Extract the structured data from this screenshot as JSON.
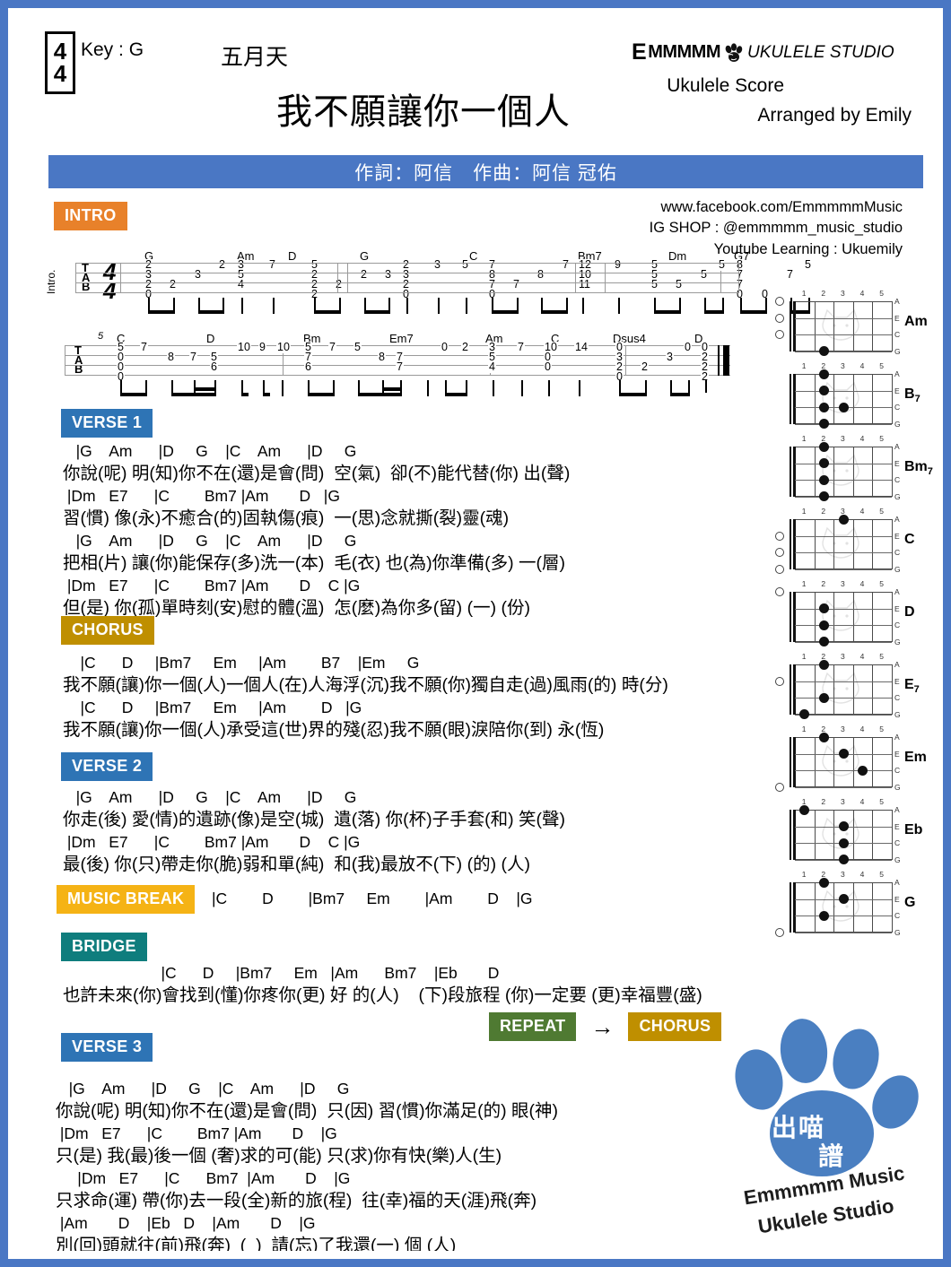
{
  "header": {
    "time_signature_top": "4",
    "time_signature_bottom": "4",
    "key": "Key : G",
    "artist": "五月天",
    "title": "我不願讓你一個人",
    "brand_e": "E",
    "brand_m": "MMMMM",
    "brand_tail": "UKULELE STUDIO",
    "score_label": "Ukulele Score",
    "arranged_by": "Arranged by Emily",
    "credits": "作詞：阿信　作曲：阿信 冠佑"
  },
  "social": {
    "facebook": "www.facebook.com/EmmmmmMusic",
    "ig": "IG SHOP : @emmmmm_music_studio",
    "youtube": "Youtube Learning : Ukuemily"
  },
  "tags": {
    "intro": "INTRO",
    "verse1": "VERSE 1",
    "chorus": "CHORUS",
    "verse2": "VERSE 2",
    "music_break": "MUSIC BREAK",
    "bridge": "BRIDGE",
    "repeat": "REPEAT",
    "repeat_target": "CHORUS",
    "arrow": "→",
    "verse3": "VERSE 3"
  },
  "tab": {
    "intro_label": "Intro.",
    "clef": [
      "T",
      "A",
      "B"
    ],
    "time_top": "4",
    "time_bottom": "4",
    "row1_chords": [
      "G",
      "Am",
      "D",
      "G",
      "C",
      "Bm7",
      "Dm",
      "G7"
    ],
    "row2_chords": [
      "C",
      "D",
      "Bm",
      "Em7",
      "Am",
      "C",
      "Dsus4",
      "D"
    ],
    "row2_pos_marker": "5"
  },
  "music_break_chords": "|C        D        |Bm7     Em        |Am        D    |G",
  "sections": {
    "verse1": [
      {
        "chords": "   |G    Am      |D     G    |C    Am      |D     G",
        "lyrics": "你說(呢) 明(知)你不在(還)是會(問)  空(氣)  卻(不)能代替(你) 出(聲)"
      },
      {
        "chords": " |Dm   E7      |C        Bm7 |Am       D   |G",
        "lyrics": "習(慣) 像(永)不癒合(的)固執傷(痕)  一(思)念就撕(裂)靈(魂)"
      },
      {
        "chords": "   |G    Am      |D     G    |C    Am      |D     G",
        "lyrics": "把相(片) 讓(你)能保存(多)洗一(本)  毛(衣) 也(為)你準備(多) 一(層)"
      },
      {
        "chords": " |Dm   E7      |C        Bm7 |Am       D    C |G",
        "lyrics": "但(是) 你(孤)單時刻(安)慰的體(溫)  怎(麼)為你多(留) (一) (份)"
      }
    ],
    "chorus": [
      {
        "chords": "    |C      D     |Bm7     Em     |Am        B7    |Em     G",
        "lyrics": "我不願(讓)你一個(人)一個人(在)人海浮(沉)我不願(你)獨自走(過)風雨(的) 時(分)"
      },
      {
        "chords": "    |C      D     |Bm7     Em     |Am        D   |G",
        "lyrics": "我不願(讓)你一個(人)承受這(世)界的殘(忍)我不願(眼)淚陪你(到) 永(恆)"
      }
    ],
    "verse2": [
      {
        "chords": "   |G    Am      |D     G    |C    Am      |D     G",
        "lyrics": "你走(後) 愛(情)的遺跡(像)是空(城)  遺(落) 你(杯)子手套(和) 笑(聲)"
      },
      {
        "chords": " |Dm   E7      |C        Bm7 |Am       D    C |G",
        "lyrics": "最(後) 你(只)帶走你(脆)弱和單(純)  和(我)最放不(下) (的) (人)"
      }
    ],
    "bridge": [
      {
        "chords": "    |C      D     |Bm7     Em   |Am      Bm7    |Eb       D",
        "lyrics": "也許未來(你)會找到(懂)你疼你(更) 好 的(人)    (下)段旅程 (你)一定要 (更)幸福豐(盛)"
      }
    ],
    "verse3": [
      {
        "chords": "   |G    Am      |D     G    |C    Am      |D     G",
        "lyrics": "你說(呢) 明(知)你不在(還)是會(問)  只(因) 習(慣)你滿足(的) 眼(神)"
      },
      {
        "chords": " |Dm   E7      |C        Bm7 |Am       D    |G",
        "lyrics": "只(是) 我(最)後一個 (奢)求的可(能) 只(求)你有快(樂)人(生)"
      },
      {
        "chords": "     |Dm   E7      |C      Bm7  |Am       D    |G",
        "lyrics": "只求命(運) 帶(你)去一段(全)新的旅(程)  往(幸)福的天(涯)飛(奔)"
      },
      {
        "chords": " |Am       D    |Eb   D    |Am       D    |G",
        "lyrics": "別(回)頭就往(前)飛(奔)  (  )  請(忘)了我還(一) 個 (人)"
      }
    ]
  },
  "chord_diagrams": [
    {
      "name": "Am",
      "sub": "",
      "fret_numbers": [
        "1",
        "2",
        "3",
        "4",
        "5"
      ],
      "string_names": [
        "A",
        "E",
        "C",
        "G"
      ],
      "open_strings": [
        0,
        1,
        2
      ],
      "dots": [
        {
          "string": 3,
          "fret": 2
        }
      ]
    },
    {
      "name": "B",
      "sub": "7",
      "fret_numbers": [
        "1",
        "2",
        "3",
        "4",
        "5"
      ],
      "string_names": [
        "A",
        "E",
        "C",
        "G"
      ],
      "open_strings": [],
      "dots": [
        {
          "string": 0,
          "fret": 2
        },
        {
          "string": 1,
          "fret": 2
        },
        {
          "string": 2,
          "fret": 2
        },
        {
          "string": 3,
          "fret": 2
        },
        {
          "string": 2,
          "fret": 3
        }
      ]
    },
    {
      "name": "Bm",
      "sub": "7",
      "fret_numbers": [
        "1",
        "2",
        "3",
        "4",
        "5"
      ],
      "string_names": [
        "A",
        "E",
        "C",
        "G"
      ],
      "open_strings": [],
      "dots": [
        {
          "string": 0,
          "fret": 2
        },
        {
          "string": 1,
          "fret": 2
        },
        {
          "string": 2,
          "fret": 2
        },
        {
          "string": 3,
          "fret": 2
        }
      ]
    },
    {
      "name": "C",
      "sub": "",
      "fret_numbers": [
        "1",
        "2",
        "3",
        "4",
        "5"
      ],
      "string_names": [
        "A",
        "E",
        "C",
        "G"
      ],
      "open_strings": [
        1,
        2,
        3
      ],
      "dots": [
        {
          "string": 0,
          "fret": 3
        }
      ]
    },
    {
      "name": "D",
      "sub": "",
      "fret_numbers": [
        "1",
        "2",
        "3",
        "4",
        "5"
      ],
      "string_names": [
        "A",
        "E",
        "C",
        "G"
      ],
      "open_strings": [
        0
      ],
      "dots": [
        {
          "string": 1,
          "fret": 2
        },
        {
          "string": 2,
          "fret": 2
        },
        {
          "string": 3,
          "fret": 2
        }
      ]
    },
    {
      "name": "E",
      "sub": "7",
      "fret_numbers": [
        "1",
        "2",
        "3",
        "4",
        "5"
      ],
      "string_names": [
        "A",
        "E",
        "C",
        "G"
      ],
      "open_strings": [
        1
      ],
      "dots": [
        {
          "string": 0,
          "fret": 2
        },
        {
          "string": 2,
          "fret": 2
        },
        {
          "string": 3,
          "fret": 1
        }
      ]
    },
    {
      "name": "Em",
      "sub": "",
      "fret_numbers": [
        "1",
        "2",
        "3",
        "4",
        "5"
      ],
      "string_names": [
        "A",
        "E",
        "C",
        "G"
      ],
      "open_strings": [
        3
      ],
      "dots": [
        {
          "string": 0,
          "fret": 2
        },
        {
          "string": 1,
          "fret": 3
        },
        {
          "string": 2,
          "fret": 4
        }
      ]
    },
    {
      "name": "Eb",
      "sub": "",
      "fret_numbers": [
        "1",
        "2",
        "3",
        "4",
        "5"
      ],
      "string_names": [
        "A",
        "E",
        "C",
        "G"
      ],
      "open_strings": [],
      "dots": [
        {
          "string": 0,
          "fret": 1
        },
        {
          "string": 1,
          "fret": 3
        },
        {
          "string": 2,
          "fret": 3
        },
        {
          "string": 3,
          "fret": 3
        }
      ]
    },
    {
      "name": "G",
      "sub": "",
      "fret_numbers": [
        "1",
        "2",
        "3",
        "4",
        "5"
      ],
      "string_names": [
        "A",
        "E",
        "C",
        "G"
      ],
      "open_strings": [
        3
      ],
      "dots": [
        {
          "string": 0,
          "fret": 2
        },
        {
          "string": 1,
          "fret": 3
        },
        {
          "string": 2,
          "fret": 2
        }
      ]
    }
  ],
  "logo": {
    "cn_top": "出喵",
    "cn_bottom": "譜",
    "line1": "Emmmmm Music",
    "line2": "Ukulele Studio"
  },
  "colors": {
    "border_blue": "#4a77c4",
    "intro_orange": "#e8812a",
    "verse_blue": "#2e74b5",
    "chorus_gold": "#bf8f00",
    "break_yellow": "#f5b315",
    "bridge_teal": "#0f7d7d",
    "repeat_green": "#4f7a32",
    "paw_blue": "#4a7fc1"
  }
}
